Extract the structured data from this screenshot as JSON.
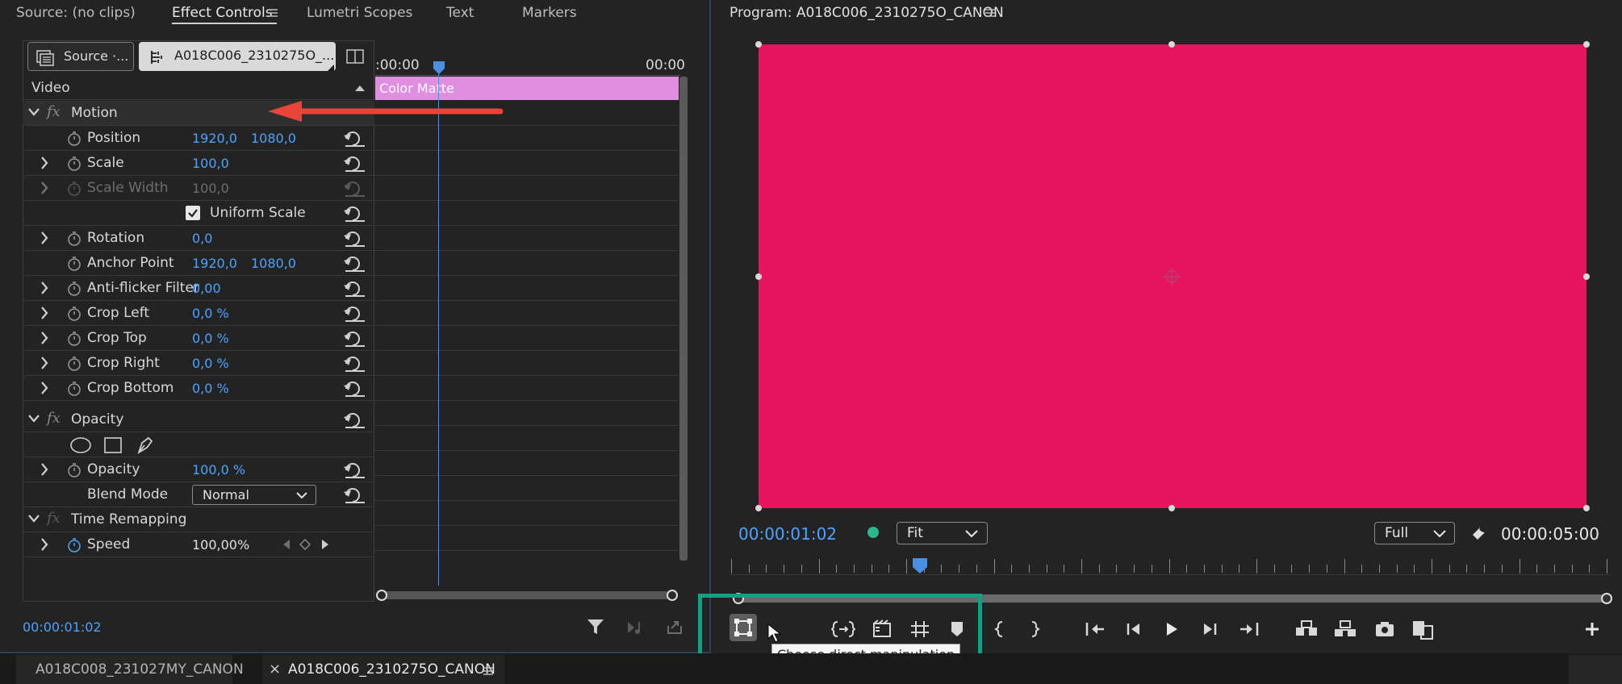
{
  "left_tabs": {
    "source": "Source: (no clips)",
    "effect_controls": "Effect Controls",
    "lumetri_scopes": "Lumetri Scopes",
    "text": "Text",
    "markers": "Markers"
  },
  "program": {
    "title": "Program: A018C006_2310275O_CANON"
  },
  "effect_controls": {
    "source_btn": "Source ·...",
    "clip_btn": "A018C006_2310275O_...",
    "time_start": ":00:00",
    "time_end": "00:00",
    "section_video": "Video",
    "clip_bar_label": "Color Matte",
    "motion": "Motion",
    "properties": [
      {
        "name": "Position",
        "v1": "1920,0",
        "v2": "1080,0"
      },
      {
        "name": "Scale",
        "v1": "100,0"
      },
      {
        "name": "Scale Width",
        "v1": "100,0"
      },
      {
        "name": "Uniform Scale"
      },
      {
        "name": "Rotation",
        "v1": "0,0"
      },
      {
        "name": "Anchor Point",
        "v1": "1920,0",
        "v2": "1080,0"
      },
      {
        "name": "Anti-flicker Filter",
        "v1": "0,00"
      },
      {
        "name": "Crop Left",
        "v1": "0,0 %"
      },
      {
        "name": "Crop Top",
        "v1": "0,0 %"
      },
      {
        "name": "Crop Right",
        "v1": "0,0 %"
      },
      {
        "name": "Crop Bottom",
        "v1": "0,0 %"
      }
    ],
    "opacity_group": "Opacity",
    "opacity_prop": {
      "name": "Opacity",
      "v1": "100,0 %"
    },
    "blend_mode": {
      "name": "Blend Mode",
      "value": "Normal"
    },
    "time_remapping": "Time Remapping",
    "speed": {
      "name": "Speed",
      "value": "100,00%"
    },
    "timecode": "00:00:01:02"
  },
  "monitor": {
    "current_tc": "00:00:01:02",
    "fit": "Fit",
    "full": "Full",
    "duration": "00:00:05:00",
    "tooltip": "Choose direct manipulation"
  },
  "bottom_tabs": {
    "seq1": "A018C008_231027MY_CANON",
    "seq2": "A018C006_2310275O_CANON",
    "close": "×"
  },
  "colors": {
    "matte": "#e6135d",
    "clip_bar": "#e08ee0",
    "accent_blue": "#4da3ff",
    "highlight_box": "#13a085",
    "arrow": "#e8443a"
  },
  "icons": [
    "stopwatch-icon",
    "reset-icon",
    "chevron-right-icon",
    "chevron-down-icon",
    "menu-icon",
    "filter-icon",
    "play-icon",
    "wrench-icon",
    "camera-icon",
    "plus-icon",
    "ellipse-mask-icon",
    "rect-mask-icon",
    "pen-icon"
  ]
}
